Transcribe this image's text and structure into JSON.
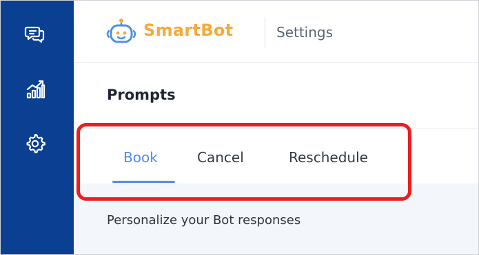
{
  "sidebar": {
    "items": [
      {
        "icon": "chat-icon"
      },
      {
        "icon": "analytics-icon"
      },
      {
        "icon": "gear-icon"
      }
    ],
    "background": "#0b3f91"
  },
  "header": {
    "brand": "SmartBot",
    "brand_color": "#f6a93b",
    "logo_icon": "robot-icon",
    "section": "Settings"
  },
  "prompts": {
    "title": "Prompts",
    "tabs": [
      {
        "label": "Book",
        "active": true
      },
      {
        "label": "Cancel",
        "active": false
      },
      {
        "label": "Reschedule",
        "active": false
      }
    ],
    "active_color": "#4a8df0",
    "description": "Personalize your Bot responses"
  },
  "annotation": {
    "color": "#ee1c1c"
  }
}
